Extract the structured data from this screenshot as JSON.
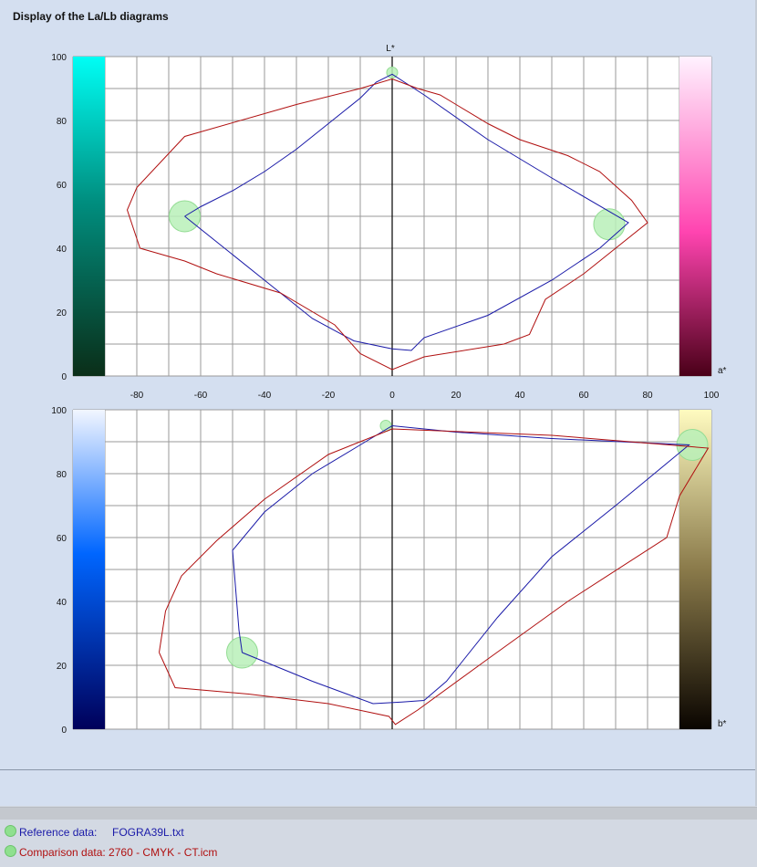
{
  "window": {
    "title": "Display of the La/Lb diagrams"
  },
  "legend": {
    "reference": {
      "label": "Reference data:",
      "value": "FOGRA39L.txt",
      "color": "#1a1aa8"
    },
    "comparison": {
      "label": "Comparison data: 2760 - CMYK - CT.icm",
      "color": "#b01010"
    }
  },
  "chart_data": [
    {
      "type": "line",
      "name": "La diagram",
      "top_axis_label": "L*",
      "corner_label": "a*",
      "xlim": [
        -100,
        100
      ],
      "ylim": [
        0,
        100
      ],
      "xticks": [
        -80,
        -60,
        -40,
        -20,
        0,
        20,
        40,
        60,
        80,
        100
      ],
      "yticks": [
        0,
        20,
        40,
        60,
        80,
        100
      ],
      "grid": true,
      "left_color_bar": [
        "#00fef5",
        "#0a2e18"
      ],
      "right_color_bar": [
        "#fff2ff",
        "#ff44b0",
        "#4a0018"
      ],
      "series": [
        {
          "color": "#1a1aa8",
          "points": [
            [
              -65,
              50
            ],
            [
              -60,
              53
            ],
            [
              -50,
              58
            ],
            [
              -40,
              64
            ],
            [
              -30,
              71
            ],
            [
              -20,
              79
            ],
            [
              -10,
              87
            ],
            [
              -5,
              92
            ],
            [
              0,
              94.5
            ],
            [
              10,
              88
            ],
            [
              30,
              74
            ],
            [
              50,
              62
            ],
            [
              74,
              48
            ],
            [
              65,
              40
            ],
            [
              50,
              30
            ],
            [
              30,
              19
            ],
            [
              10,
              12
            ],
            [
              6,
              8
            ],
            [
              0,
              8.5
            ],
            [
              -12,
              11
            ],
            [
              -25,
              18
            ],
            [
              -40,
              30
            ],
            [
              -55,
              42
            ],
            [
              -65,
              50
            ]
          ]
        },
        {
          "color": "#b01010",
          "points": [
            [
              -79,
              40
            ],
            [
              -83,
              52
            ],
            [
              -80,
              59
            ],
            [
              -65,
              75
            ],
            [
              -30,
              85
            ],
            [
              -10,
              90
            ],
            [
              0,
              93
            ],
            [
              8,
              90
            ],
            [
              15,
              88
            ],
            [
              20,
              85
            ],
            [
              30,
              79
            ],
            [
              40,
              74
            ],
            [
              55,
              69
            ],
            [
              65,
              64
            ],
            [
              75,
              55
            ],
            [
              80,
              48
            ],
            [
              70,
              40
            ],
            [
              60,
              32
            ],
            [
              48,
              24
            ],
            [
              43,
              13
            ],
            [
              35,
              10
            ],
            [
              10,
              6
            ],
            [
              0,
              2
            ],
            [
              -10,
              7
            ],
            [
              -18,
              16
            ],
            [
              -35,
              26
            ],
            [
              -55,
              32
            ],
            [
              -65,
              36
            ],
            [
              -79,
              40
            ]
          ]
        }
      ],
      "markers": [
        {
          "x": 0,
          "y": 95,
          "size": "small"
        },
        {
          "x": -65,
          "y": 50,
          "size": "large"
        },
        {
          "x": 68,
          "y": 47.5,
          "size": "large"
        }
      ]
    },
    {
      "type": "line",
      "name": "Lb diagram",
      "corner_label": "b*",
      "xlim": [
        -100,
        100
      ],
      "ylim": [
        0,
        100
      ],
      "yticks": [
        0,
        20,
        40,
        60,
        80,
        100
      ],
      "grid": true,
      "left_color_bar": [
        "#f2f6ff",
        "#0066ff",
        "#00005a"
      ],
      "right_color_bar": [
        "#fffbc0",
        "#8a7a4a",
        "#0a0500"
      ],
      "series": [
        {
          "color": "#1a1aa8",
          "points": [
            [
              -47,
              24
            ],
            [
              -48,
              31
            ],
            [
              -50,
              56
            ],
            [
              -40,
              68
            ],
            [
              -25,
              80
            ],
            [
              -10,
              89
            ],
            [
              0,
              95
            ],
            [
              20,
              93
            ],
            [
              50,
              91
            ],
            [
              93,
              89
            ],
            [
              70,
              70
            ],
            [
              50,
              54
            ],
            [
              33,
              35
            ],
            [
              17,
              15
            ],
            [
              10,
              9
            ],
            [
              3,
              8.5
            ],
            [
              -6,
              8
            ],
            [
              -25,
              15
            ],
            [
              -47,
              24
            ]
          ]
        },
        {
          "color": "#b01010",
          "points": [
            [
              -73,
              24
            ],
            [
              -71,
              37
            ],
            [
              -66,
              48
            ],
            [
              -55,
              59
            ],
            [
              -40,
              72
            ],
            [
              -20,
              86
            ],
            [
              0,
              94
            ],
            [
              50,
              92
            ],
            [
              99,
              88
            ],
            [
              90,
              73
            ],
            [
              86,
              60
            ],
            [
              55,
              40
            ],
            [
              30,
              22
            ],
            [
              8,
              6
            ],
            [
              1,
              1.5
            ],
            [
              -1,
              4
            ],
            [
              -20,
              8
            ],
            [
              -45,
              11
            ],
            [
              -68,
              13
            ],
            [
              -73,
              24
            ]
          ]
        }
      ],
      "markers": [
        {
          "x": -2,
          "y": 95,
          "size": "small"
        },
        {
          "x": -47,
          "y": 24,
          "size": "large"
        },
        {
          "x": 94,
          "y": 89,
          "size": "large"
        }
      ]
    }
  ]
}
